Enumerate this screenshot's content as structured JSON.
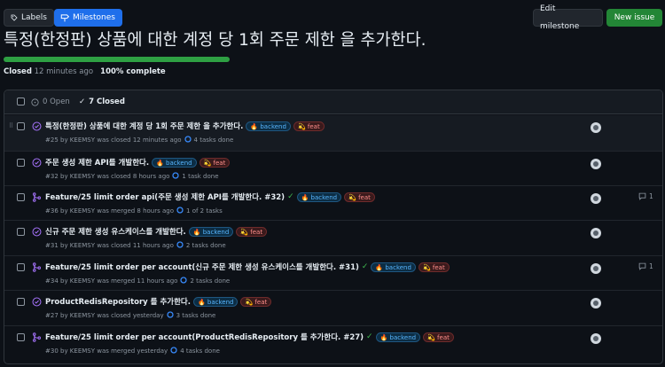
{
  "nav": {
    "labels": "Labels",
    "milestones": "Milestones"
  },
  "actions": {
    "edit": "Edit milestone",
    "new_issue": "New issue"
  },
  "milestone": {
    "title": "특정(한정판) 상품에 대한 계정 당 1회 주문 제한 을 추가한다.",
    "progress_fraction": 1.0,
    "status_label": "Closed",
    "status_time": "12 minutes ago",
    "complete": "100% complete"
  },
  "list_header": {
    "open": "0 Open",
    "closed": "7 Closed"
  },
  "colors": {
    "accent": "#1f6feb",
    "success": "#238636",
    "closed_purple": "#a371f7",
    "merged_purple": "#a371f7"
  },
  "label_names": {
    "backend": "backend",
    "feat": "feat"
  },
  "items": [
    {
      "type": "issue",
      "title": "특정(한정판) 상품에 대한 계정 당 1회 주문 제한 을 추가한다.",
      "check": "",
      "meta": "#25 by KEEMSY was closed 12 minutes ago",
      "tasks": "4 tasks done",
      "comments": ""
    },
    {
      "type": "issue",
      "title": "주문 생성 제한 API를 개발한다.",
      "check": "",
      "meta": "#32 by KEEMSY was closed 8 hours ago",
      "tasks": "1 task done",
      "comments": ""
    },
    {
      "type": "pr",
      "title": "Feature/25 limit order api(주문 생성 제한 API를 개발한다. #32)",
      "check": "✓",
      "meta": "#36 by KEEMSY was merged 8 hours ago",
      "tasks": "1 of 2 tasks",
      "comments": "1"
    },
    {
      "type": "issue",
      "title": "신규 주문 제한 생성 유스케이스를 개발한다.",
      "check": "",
      "meta": "#31 by KEEMSY was closed 11 hours ago",
      "tasks": "2 tasks done",
      "comments": ""
    },
    {
      "type": "pr",
      "title": "Feature/25 limit order per account(신규 주문 제한 생성 유스케이스를 개발한다. #31)",
      "check": "✓",
      "meta": "#34 by KEEMSY was merged 11 hours ago",
      "tasks": "2 tasks done",
      "comments": "1"
    },
    {
      "type": "issue",
      "title": "ProductRedisRepository 를 추가한다.",
      "check": "",
      "meta": "#27 by KEEMSY was closed yesterday",
      "tasks": "3 tasks done",
      "comments": ""
    },
    {
      "type": "pr",
      "title": "Feature/25 limit order per account(ProductRedisRepository 를 추가한다. #27)",
      "check": "✓",
      "meta": "#30 by KEEMSY was merged yesterday",
      "tasks": "4 tasks done",
      "comments": ""
    }
  ]
}
